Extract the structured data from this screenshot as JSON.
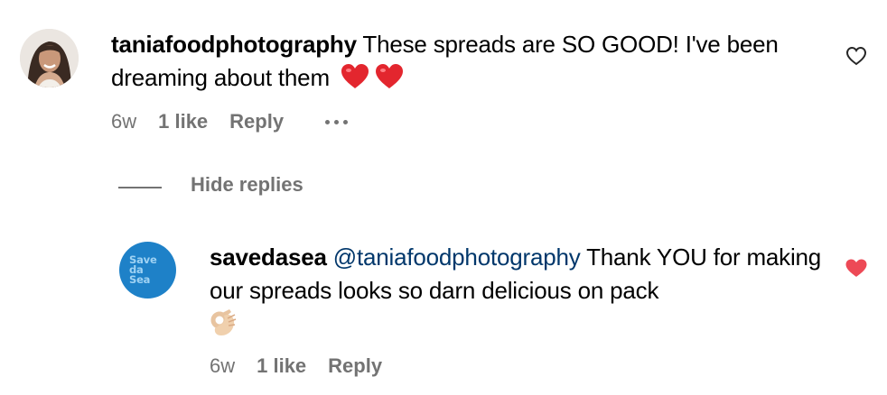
{
  "comment": {
    "username": "taniafoodphotography",
    "text": "These spreads are SO GOOD! I've been dreaming about them",
    "emoji": [
      "heart-emoji",
      "heart-emoji"
    ],
    "time": "6w",
    "likes": "1 like",
    "reply_label": "Reply",
    "more_icon": "more-horizontal-icon",
    "like_state": "not-liked"
  },
  "replies_toggle": {
    "label": "Hide replies"
  },
  "reply": {
    "username": "savedasea",
    "mention": "@taniafoodphotography",
    "text": "Thank YOU for making our spreads looks so darn delicious on pack",
    "emoji": [
      "ok-hand-emoji"
    ],
    "avatar_logo": [
      "Save",
      "da",
      "Sea"
    ],
    "time": "6w",
    "likes": "1 like",
    "reply_label": "Reply",
    "like_state": "liked"
  },
  "colors": {
    "text": "#000000",
    "secondary": "#737373",
    "mention": "#00376b",
    "liked_heart": "#ed4956",
    "brand_avatar": "#1e81c8"
  }
}
